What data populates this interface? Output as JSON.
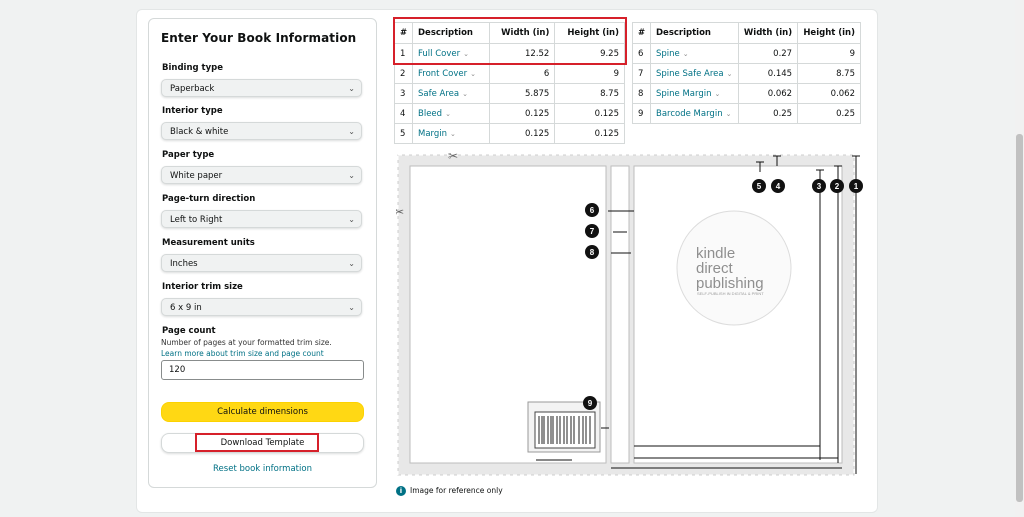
{
  "form": {
    "title": "Enter Your Book Information",
    "fields": [
      {
        "label": "Binding type",
        "value": "Paperback"
      },
      {
        "label": "Interior type",
        "value": "Black & white"
      },
      {
        "label": "Paper type",
        "value": "White paper"
      },
      {
        "label": "Page-turn direction",
        "value": "Left to Right"
      },
      {
        "label": "Measurement units",
        "value": "Inches"
      },
      {
        "label": "Interior trim size",
        "value": "6 x 9 in"
      }
    ],
    "page_count": {
      "label": "Page count",
      "help": "Number of pages at your formatted trim size.",
      "link": "Learn more about trim size and page count",
      "value": "120"
    },
    "calculate_label": "Calculate dimensions",
    "download_label": "Download Template",
    "reset_label": "Reset book information"
  },
  "table_headers": {
    "num": "#",
    "desc": "Description",
    "width": "Width (in)",
    "height": "Height (in)"
  },
  "table_left": [
    {
      "num": "1",
      "desc": "Full Cover",
      "width": "12.52",
      "height": "9.25"
    },
    {
      "num": "2",
      "desc": "Front Cover",
      "width": "6",
      "height": "9"
    },
    {
      "num": "3",
      "desc": "Safe Area",
      "width": "5.875",
      "height": "8.75"
    },
    {
      "num": "4",
      "desc": "Bleed",
      "width": "0.125",
      "height": "0.125"
    },
    {
      "num": "5",
      "desc": "Margin",
      "width": "0.125",
      "height": "0.125"
    }
  ],
  "table_right": [
    {
      "num": "6",
      "desc": "Spine",
      "width": "0.27",
      "height": "9"
    },
    {
      "num": "7",
      "desc": "Spine Safe Area",
      "width": "0.145",
      "height": "8.75"
    },
    {
      "num": "8",
      "desc": "Spine Margin",
      "width": "0.062",
      "height": "0.062"
    },
    {
      "num": "9",
      "desc": "Barcode Margin",
      "width": "0.25",
      "height": "0.25"
    }
  ],
  "diagram": {
    "logo_line1": "kindle",
    "logo_line2": "direct",
    "logo_line3": "publishing",
    "logo_tagline": "SELF-PUBLISH IN DIGITAL & PRINT",
    "reference_note": "Image for reference only",
    "markers": [
      "1",
      "2",
      "3",
      "4",
      "5",
      "6",
      "7",
      "8",
      "9"
    ]
  },
  "colors": {
    "accent": "#007185",
    "button": "#ffd814",
    "highlight": "#d6202a"
  }
}
